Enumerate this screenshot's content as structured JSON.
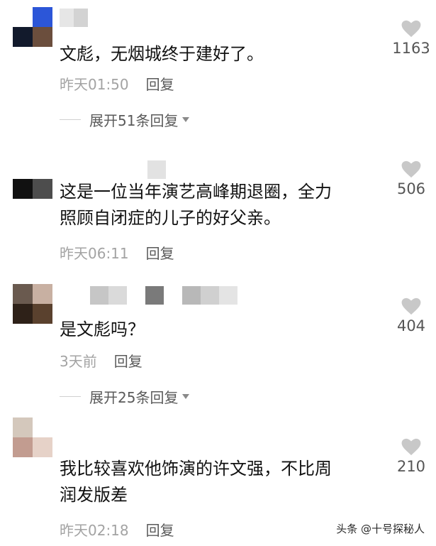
{
  "comments": [
    {
      "text_lines": [
        "文彪，无烟城终于建好了。"
      ],
      "time": "昨天01:50",
      "reply_label": "回复",
      "likes": "1163",
      "expand_label": "展开51条回复"
    },
    {
      "text_lines": [
        "这是一位当年演艺高峰期退圈，全力",
        "照顾自闭症的儿子的好父亲。"
      ],
      "time": "昨天06:11",
      "reply_label": "回复",
      "likes": "506"
    },
    {
      "text_lines": [
        "是文彪吗？"
      ],
      "time": "3天前",
      "reply_label": "回复",
      "likes": "404",
      "expand_label": "展开25条回复"
    },
    {
      "text_lines": [
        "我比较喜欢他饰演的许文强，不比周",
        "润发版差"
      ],
      "time": "昨天02:18",
      "reply_label": "回复",
      "likes": "210"
    }
  ],
  "watermark": "头条 @十号探秘人",
  "colors": {
    "reply": "#5a5a5a",
    "time": "#a3a3a3",
    "heart": "#c8c8c8"
  },
  "icons": {
    "like": "heart-icon",
    "expand": "caret-down-icon"
  }
}
